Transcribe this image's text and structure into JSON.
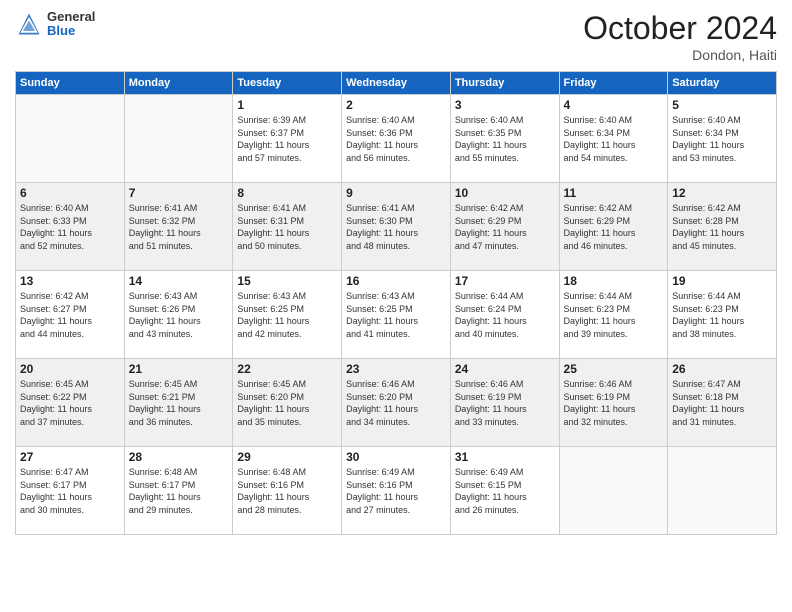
{
  "header": {
    "logo_general": "General",
    "logo_blue": "Blue",
    "month": "October 2024",
    "location": "Dondon, Haiti"
  },
  "days_of_week": [
    "Sunday",
    "Monday",
    "Tuesday",
    "Wednesday",
    "Thursday",
    "Friday",
    "Saturday"
  ],
  "weeks": [
    [
      {
        "day": "",
        "info": ""
      },
      {
        "day": "",
        "info": ""
      },
      {
        "day": "1",
        "info": "Sunrise: 6:39 AM\nSunset: 6:37 PM\nDaylight: 11 hours\nand 57 minutes."
      },
      {
        "day": "2",
        "info": "Sunrise: 6:40 AM\nSunset: 6:36 PM\nDaylight: 11 hours\nand 56 minutes."
      },
      {
        "day": "3",
        "info": "Sunrise: 6:40 AM\nSunset: 6:35 PM\nDaylight: 11 hours\nand 55 minutes."
      },
      {
        "day": "4",
        "info": "Sunrise: 6:40 AM\nSunset: 6:34 PM\nDaylight: 11 hours\nand 54 minutes."
      },
      {
        "day": "5",
        "info": "Sunrise: 6:40 AM\nSunset: 6:34 PM\nDaylight: 11 hours\nand 53 minutes."
      }
    ],
    [
      {
        "day": "6",
        "info": "Sunrise: 6:40 AM\nSunset: 6:33 PM\nDaylight: 11 hours\nand 52 minutes."
      },
      {
        "day": "7",
        "info": "Sunrise: 6:41 AM\nSunset: 6:32 PM\nDaylight: 11 hours\nand 51 minutes."
      },
      {
        "day": "8",
        "info": "Sunrise: 6:41 AM\nSunset: 6:31 PM\nDaylight: 11 hours\nand 50 minutes."
      },
      {
        "day": "9",
        "info": "Sunrise: 6:41 AM\nSunset: 6:30 PM\nDaylight: 11 hours\nand 48 minutes."
      },
      {
        "day": "10",
        "info": "Sunrise: 6:42 AM\nSunset: 6:29 PM\nDaylight: 11 hours\nand 47 minutes."
      },
      {
        "day": "11",
        "info": "Sunrise: 6:42 AM\nSunset: 6:29 PM\nDaylight: 11 hours\nand 46 minutes."
      },
      {
        "day": "12",
        "info": "Sunrise: 6:42 AM\nSunset: 6:28 PM\nDaylight: 11 hours\nand 45 minutes."
      }
    ],
    [
      {
        "day": "13",
        "info": "Sunrise: 6:42 AM\nSunset: 6:27 PM\nDaylight: 11 hours\nand 44 minutes."
      },
      {
        "day": "14",
        "info": "Sunrise: 6:43 AM\nSunset: 6:26 PM\nDaylight: 11 hours\nand 43 minutes."
      },
      {
        "day": "15",
        "info": "Sunrise: 6:43 AM\nSunset: 6:25 PM\nDaylight: 11 hours\nand 42 minutes."
      },
      {
        "day": "16",
        "info": "Sunrise: 6:43 AM\nSunset: 6:25 PM\nDaylight: 11 hours\nand 41 minutes."
      },
      {
        "day": "17",
        "info": "Sunrise: 6:44 AM\nSunset: 6:24 PM\nDaylight: 11 hours\nand 40 minutes."
      },
      {
        "day": "18",
        "info": "Sunrise: 6:44 AM\nSunset: 6:23 PM\nDaylight: 11 hours\nand 39 minutes."
      },
      {
        "day": "19",
        "info": "Sunrise: 6:44 AM\nSunset: 6:23 PM\nDaylight: 11 hours\nand 38 minutes."
      }
    ],
    [
      {
        "day": "20",
        "info": "Sunrise: 6:45 AM\nSunset: 6:22 PM\nDaylight: 11 hours\nand 37 minutes."
      },
      {
        "day": "21",
        "info": "Sunrise: 6:45 AM\nSunset: 6:21 PM\nDaylight: 11 hours\nand 36 minutes."
      },
      {
        "day": "22",
        "info": "Sunrise: 6:45 AM\nSunset: 6:20 PM\nDaylight: 11 hours\nand 35 minutes."
      },
      {
        "day": "23",
        "info": "Sunrise: 6:46 AM\nSunset: 6:20 PM\nDaylight: 11 hours\nand 34 minutes."
      },
      {
        "day": "24",
        "info": "Sunrise: 6:46 AM\nSunset: 6:19 PM\nDaylight: 11 hours\nand 33 minutes."
      },
      {
        "day": "25",
        "info": "Sunrise: 6:46 AM\nSunset: 6:19 PM\nDaylight: 11 hours\nand 32 minutes."
      },
      {
        "day": "26",
        "info": "Sunrise: 6:47 AM\nSunset: 6:18 PM\nDaylight: 11 hours\nand 31 minutes."
      }
    ],
    [
      {
        "day": "27",
        "info": "Sunrise: 6:47 AM\nSunset: 6:17 PM\nDaylight: 11 hours\nand 30 minutes."
      },
      {
        "day": "28",
        "info": "Sunrise: 6:48 AM\nSunset: 6:17 PM\nDaylight: 11 hours\nand 29 minutes."
      },
      {
        "day": "29",
        "info": "Sunrise: 6:48 AM\nSunset: 6:16 PM\nDaylight: 11 hours\nand 28 minutes."
      },
      {
        "day": "30",
        "info": "Sunrise: 6:49 AM\nSunset: 6:16 PM\nDaylight: 11 hours\nand 27 minutes."
      },
      {
        "day": "31",
        "info": "Sunrise: 6:49 AM\nSunset: 6:15 PM\nDaylight: 11 hours\nand 26 minutes."
      },
      {
        "day": "",
        "info": ""
      },
      {
        "day": "",
        "info": ""
      }
    ]
  ]
}
